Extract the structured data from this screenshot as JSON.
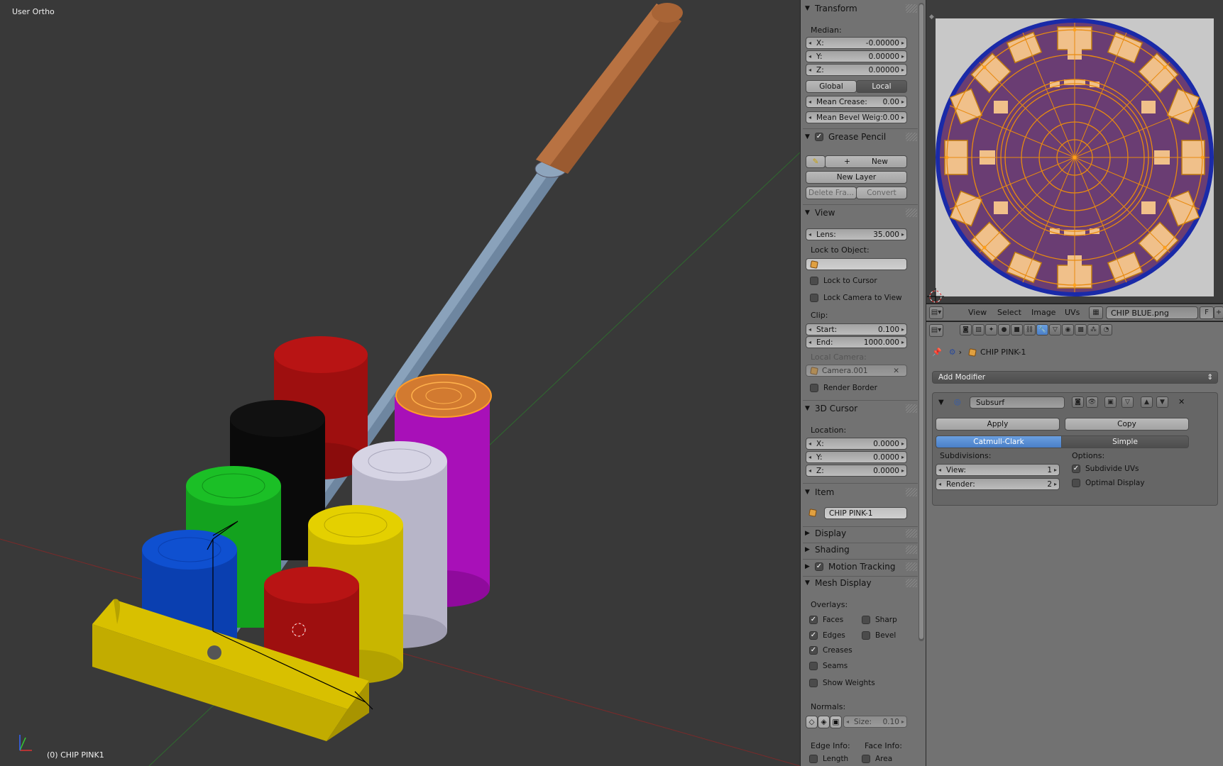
{
  "viewport": {
    "view_label": "User Ortho",
    "object_label": "(0) CHIP PINK1"
  },
  "npanel": {
    "transform": {
      "title": "Transform",
      "median_label": "Median:",
      "x_label": "X:",
      "x_value": "-0.00000",
      "y_label": "Y:",
      "y_value": "0.00000",
      "z_label": "Z:",
      "z_value": "0.00000",
      "global_label": "Global",
      "local_label": "Local",
      "mean_crease_label": "Mean Crease:",
      "mean_crease_value": "0.00",
      "mean_bevel_label": "Mean Bevel Weig:",
      "mean_bevel_value": "0.00"
    },
    "grease_pencil": {
      "title": "Grease Pencil",
      "new_label": "New",
      "new_layer_label": "New Layer",
      "delete_frame_label": "Delete Fra...",
      "convert_label": "Convert"
    },
    "view": {
      "title": "View",
      "lens_label": "Lens:",
      "lens_value": "35.000",
      "lock_object_label": "Lock to Object:",
      "lock_cursor_label": "Lock to Cursor",
      "lock_camera_label": "Lock Camera to View",
      "clip_label": "Clip:",
      "start_label": "Start:",
      "start_value": "0.100",
      "end_label": "End:",
      "end_value": "1000.000",
      "local_camera_label": "Local Camera:",
      "local_camera_value": "Camera.001",
      "render_border_label": "Render Border"
    },
    "cursor": {
      "title": "3D Cursor",
      "location_label": "Location:",
      "x_label": "X:",
      "x_value": "0.0000",
      "y_label": "Y:",
      "y_value": "0.0000",
      "z_label": "Z:",
      "z_value": "0.0000"
    },
    "item": {
      "title": "Item",
      "name_value": "CHIP PINK-1"
    },
    "display_title": "Display",
    "shading_title": "Shading",
    "motion_tracking_title": "Motion Tracking",
    "mesh_display": {
      "title": "Mesh Display",
      "overlays_label": "Overlays:",
      "faces_label": "Faces",
      "sharp_label": "Sharp",
      "edges_label": "Edges",
      "bevel_label": "Bevel",
      "creases_label": "Creases",
      "seams_label": "Seams",
      "show_weights_label": "Show Weights",
      "normals_label": "Normals:",
      "size_label": "Size:",
      "size_value": "0.10",
      "edge_info_label": "Edge Info:",
      "face_info_label": "Face Info:",
      "length_label": "Length",
      "area_label": "Area"
    }
  },
  "uv_header": {
    "view_label": "View",
    "select_label": "Select",
    "image_label": "Image",
    "uvs_label": "UVs",
    "image_name": "CHIP BLUE.png",
    "fake_user_label": "F"
  },
  "properties": {
    "object_name": "CHIP PINK-1",
    "add_modifier_label": "Add Modifier",
    "modifier_name": "Subsurf",
    "apply_label": "Apply",
    "copy_label": "Copy",
    "catmull_label": "Catmull-Clark",
    "simple_label": "Simple",
    "subdivisions_label": "Subdivisions:",
    "options_label": "Options:",
    "view_label": "View:",
    "view_value": "1",
    "render_label": "Render:",
    "render_value": "2",
    "subdivide_uvs_label": "Subdivide UVs",
    "optimal_display_label": "Optimal Display"
  },
  "colors": {
    "viewport_bg": "#393939",
    "panel_bg": "#727272",
    "accent_blue": "#5a8fd6",
    "selection_orange": "#ff8c1a",
    "uv_face_purple": "#6a3d73",
    "uv_island_peach": "#f0c08a"
  }
}
